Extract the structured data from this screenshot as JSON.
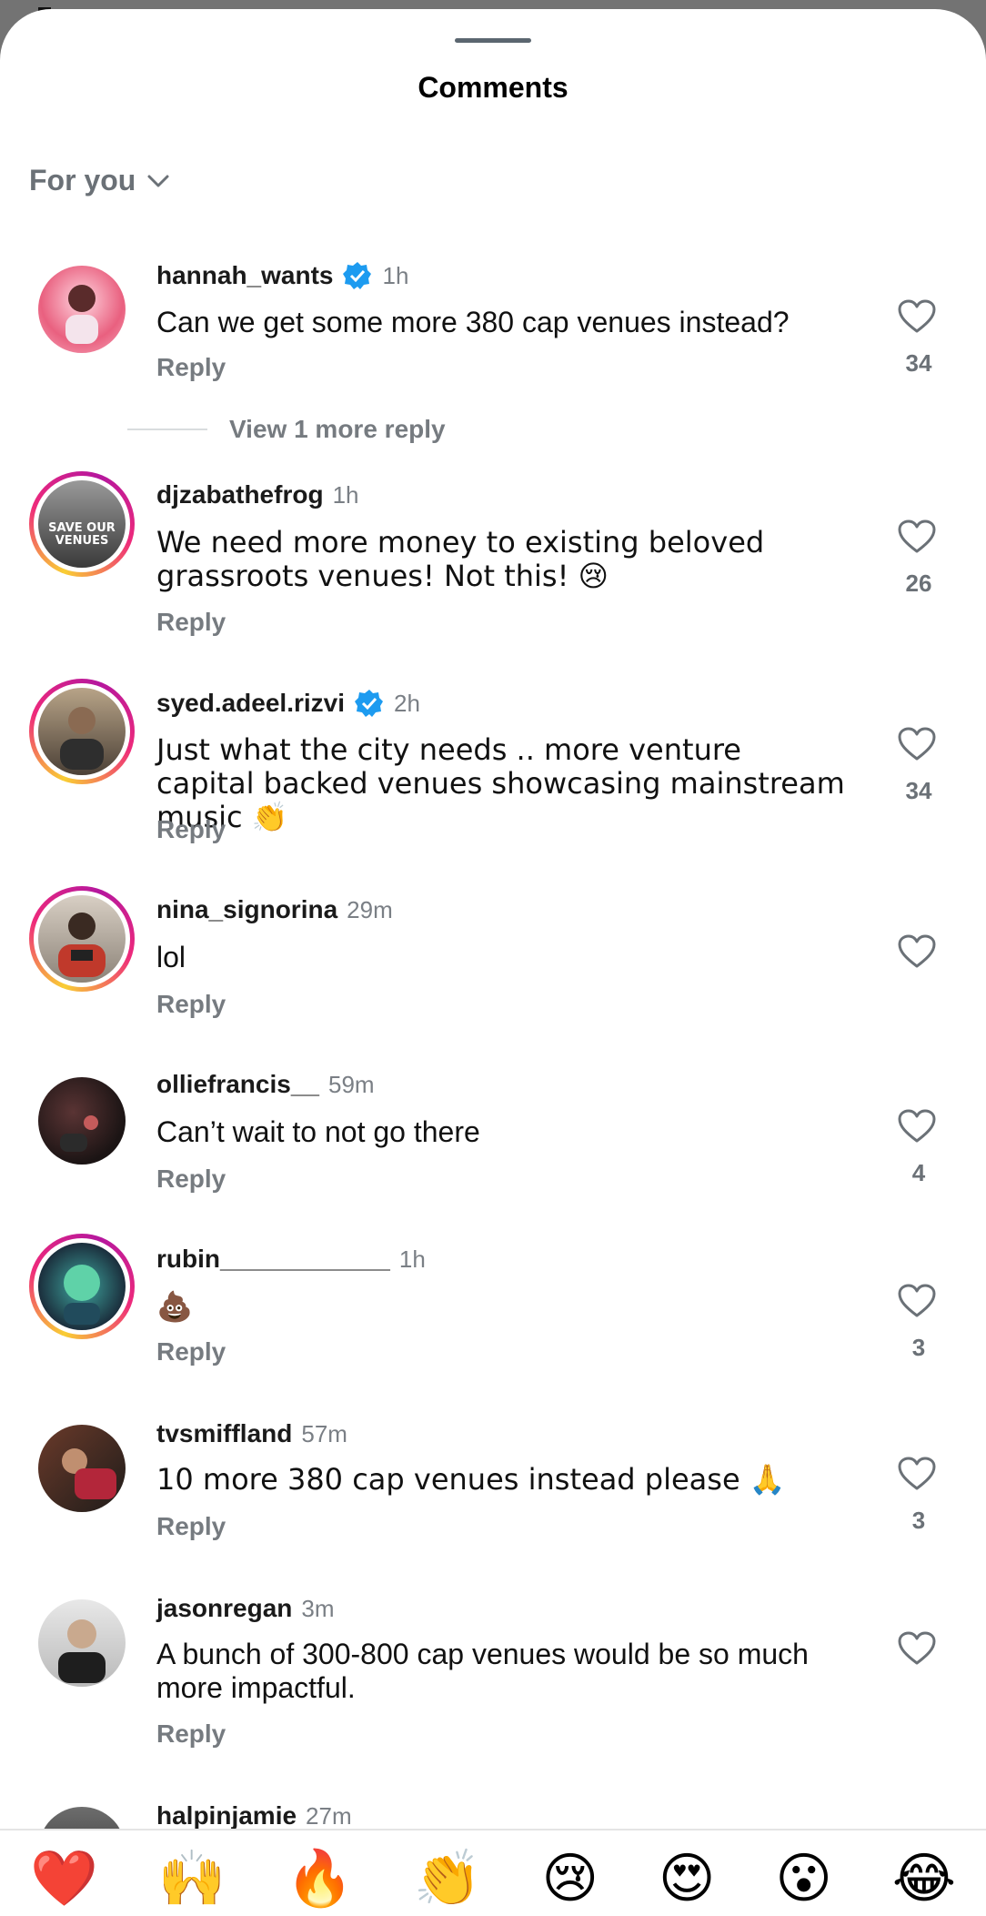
{
  "header": {
    "title": "Comments",
    "filter_label": "For you"
  },
  "view_more": "View 1 more reply",
  "reply_label": "Reply",
  "comments": [
    {
      "username": "hannah_wants",
      "verified": true,
      "time": "1h",
      "text": "Can we get some more 380 cap venues instead?",
      "likes": "34"
    },
    {
      "username": "djzabathefrog",
      "verified": false,
      "time": "1h",
      "text": "We need more money to existing beloved grassroots venues! Not this! 😢",
      "likes": "26"
    },
    {
      "username": "syed.adeel.rizvi",
      "verified": true,
      "time": "2h",
      "text": "Just what the city needs .. more venture capital backed venues showcasing mainstream music 👏",
      "likes": "34"
    },
    {
      "username": "nina_signorina",
      "verified": false,
      "time": "29m",
      "text": "lol",
      "likes": ""
    },
    {
      "username": "olliefrancis__",
      "verified": false,
      "time": "59m",
      "text": "Can’t wait to not go there",
      "likes": "4"
    },
    {
      "username": "rubin____________",
      "verified": false,
      "time": "1h",
      "text": "💩",
      "likes": "3"
    },
    {
      "username": "tvsmiffland",
      "verified": false,
      "time": "57m",
      "text": "10 more 380 cap venues instead please 🙏",
      "likes": "3"
    },
    {
      "username": "jasonregan",
      "verified": false,
      "time": "3m",
      "text": "A bunch of 300-800 cap venues would be so much more impactful.",
      "likes": ""
    },
    {
      "username": "halpinjamie",
      "verified": false,
      "time": "27m",
      "text": "",
      "likes": ""
    }
  ],
  "avatar_texts": {
    "djzabathefrog": "SAVE OUR VENUES"
  },
  "emoji_reactions": [
    "❤️",
    "🙌",
    "🔥",
    "👏",
    "😢",
    "😍",
    "😮",
    "😂"
  ],
  "colors": {
    "verified": "#1d9bf0",
    "muted": "#767b80"
  }
}
